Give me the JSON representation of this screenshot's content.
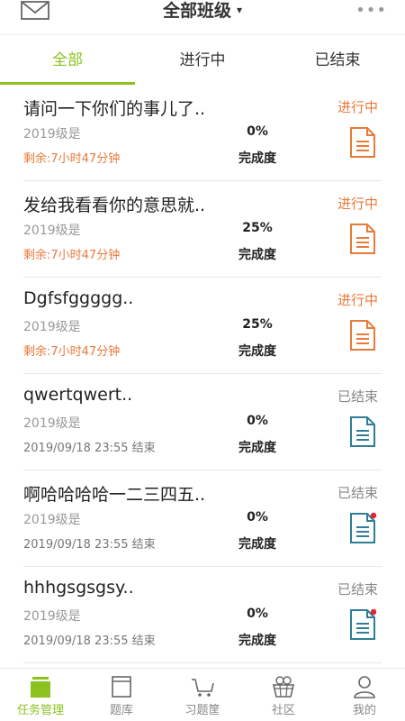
{
  "header": {
    "title": "全部班级",
    "caret": "▾",
    "more": "•••"
  },
  "tabs": [
    {
      "label": "全部",
      "active": true
    },
    {
      "label": "进行中",
      "active": false
    },
    {
      "label": "已结束",
      "active": false
    }
  ],
  "tasks": [
    {
      "title": "请问一下你们的事儿了..",
      "class": "2019级是",
      "remain": "剩余:7小时47分钟",
      "percent": "0%",
      "percent_label": "完成度",
      "status": "进行中",
      "state": "ongoing",
      "badge": false
    },
    {
      "title": "发给我看看你的意思就..",
      "class": "2019级是",
      "remain": "剩余:7小时47分钟",
      "percent": "25%",
      "percent_label": "完成度",
      "status": "进行中",
      "state": "ongoing",
      "badge": false
    },
    {
      "title": "Dgfsfggggg..",
      "class": "2019级是",
      "remain": "剩余:7小时47分钟",
      "percent": "25%",
      "percent_label": "完成度",
      "status": "进行中",
      "state": "ongoing",
      "badge": false
    },
    {
      "title": "qwertqwert..",
      "class": "2019级是",
      "remain": "2019/09/18 23:55 结束",
      "percent": "0%",
      "percent_label": "完成度",
      "status": "已结束",
      "state": "ended",
      "badge": false
    },
    {
      "title": "啊哈哈哈哈一二三四五..",
      "class": "2019级是",
      "remain": "2019/09/18 23:55 结束",
      "percent": "0%",
      "percent_label": "完成度",
      "status": "已结束",
      "state": "ended",
      "badge": true
    },
    {
      "title": "hhhgsgsgsy..",
      "class": "2019级是",
      "remain": "2019/09/18 23:55 结束",
      "percent": "0%",
      "percent_label": "完成度",
      "status": "已结束",
      "state": "ended",
      "badge": true
    }
  ],
  "bottom_nav": [
    {
      "label": "任务管理",
      "icon": "task-folder-icon",
      "active": true
    },
    {
      "label": "题库",
      "icon": "question-bank-icon",
      "active": false
    },
    {
      "label": "习题筐",
      "icon": "exercise-basket-icon",
      "active": false
    },
    {
      "label": "社区",
      "icon": "community-basket-icon",
      "active": false
    },
    {
      "label": "我的",
      "icon": "profile-icon",
      "active": false
    }
  ],
  "colors": {
    "accent": "#8bc21f",
    "ongoing": "#e87a3a",
    "ended_icon": "#2f7e96",
    "badge": "#e0262e"
  }
}
